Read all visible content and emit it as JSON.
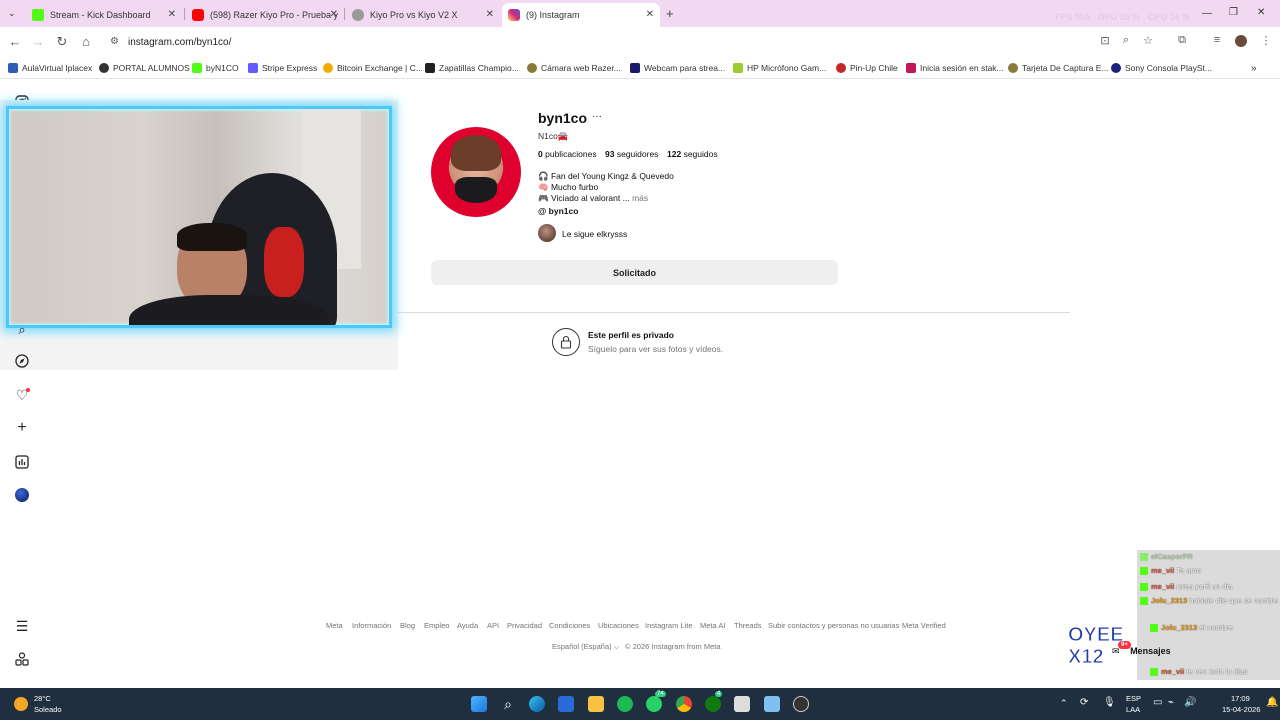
{
  "browser": {
    "tabs": [
      {
        "label": "Stream - Kick Dashboard",
        "color": "#53fc18"
      },
      {
        "label": "(598) Razer Kiyo Pro - Prueba y",
        "color": "#ff0000"
      },
      {
        "label": "Kiyo Pro vs Kiyo V2 X",
        "color": "#888888"
      },
      {
        "label": "(9) Instagram",
        "color": "#e1306c"
      }
    ],
    "new_tab": "+",
    "window_stats": {
      "fps_label": "FPS",
      "fps_value": "N/A",
      "gpu_label": "GPU",
      "gpu_value": "36 %",
      "cpu_label": "CPU",
      "cpu_value": "14 %"
    },
    "url": "instagram.com/byn1co/",
    "bookmarks": [
      {
        "label": "AulaVirtual Iplacex",
        "color": "#2b5fb3"
      },
      {
        "label": "PORTAL ALUMNOS",
        "color": "#333333"
      },
      {
        "label": "byN1CO",
        "color": "#53fc18"
      },
      {
        "label": "Stripe Express",
        "color": "#635bff"
      },
      {
        "label": "Bitcoin Exchange | C...",
        "color": "#f2a900"
      },
      {
        "label": "Zapatillas Champio...",
        "color": "#222222"
      },
      {
        "label": "Cámara web Razer...",
        "color": "#8a7a3a"
      },
      {
        "label": "Webcam para strea...",
        "color": "#1a1a6a"
      },
      {
        "label": "HP Micrófono Gam...",
        "color": "#9ccc30"
      },
      {
        "label": "Pin-Up Chile",
        "color": "#c62828"
      },
      {
        "label": "Inicia sesión en stak...",
        "color": "#c2185b"
      },
      {
        "label": "Tarjeta De Captura E...",
        "color": "#8a7a3a"
      },
      {
        "label": "Sony Consola PlaySt...",
        "color": "#1a237e"
      }
    ]
  },
  "profile": {
    "username": "byn1co",
    "more": "···",
    "display_name": "N1co🚘",
    "stats": {
      "posts_count": "0",
      "posts_label": "publicaciones",
      "followers_count": "93",
      "followers_label": "seguidores",
      "following_count": "122",
      "following_label": "seguidos"
    },
    "bio": [
      "🎧 Fan del Young Kingz & Quevedo",
      "🧠 Mucho furbo",
      "🎮 Viciado al valorant ..."
    ],
    "bio_more": "más",
    "threads_handle": "byn1co",
    "followed_by_prefix": "Le sigue",
    "followed_by_user": "elkrysss",
    "follow_button": "Solicitado",
    "private_title": "Este perfil es privado",
    "private_subtitle": "Síguelo para ver sus fotos y vídeos."
  },
  "footer": {
    "links": [
      "Meta",
      "Información",
      "Blog",
      "Empleo",
      "Ayuda",
      "API",
      "Privacidad",
      "Condiciones",
      "Ubicaciones",
      "Instagram Lite",
      "Meta AI",
      "Threads",
      "Subir contactos y personas no usuarias",
      "Meta Verified"
    ],
    "language": "Español (España)",
    "copyright": "© 2026 Instagram from Meta"
  },
  "messages": {
    "label": "Mensajes",
    "badge": "9+"
  },
  "chat": {
    "lines": [
      {
        "user": "elCasperFR",
        "text": ""
      },
      {
        "user": "me_vii",
        "text": "Te amo"
      },
      {
        "user": "me_vii",
        "text": "rolea porfi un dia"
      },
      {
        "user": "Jolu_2313",
        "text": "hablale dile que se cambie"
      },
      {
        "user": "Jolu_2313",
        "text": "el nombre"
      },
      {
        "user": "me_vii",
        "text": "te veo todo lo dias"
      }
    ],
    "overlay_text": "OYEE X12"
  },
  "taskbar": {
    "weather_temp": "28°C",
    "weather_desc": "Soleado",
    "lang": "ESP",
    "layout": "LAA",
    "time": "17:09",
    "date": "15-04-2026",
    "badge_whatsapp": "74",
    "badge_xbox": "4"
  }
}
